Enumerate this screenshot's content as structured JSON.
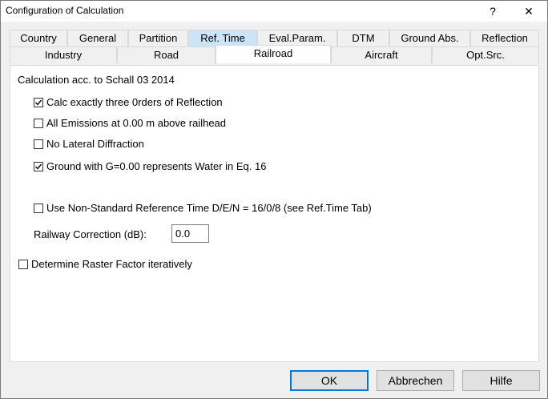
{
  "window": {
    "title": "Configuration of Calculation",
    "help_glyph": "?",
    "close_glyph": "✕"
  },
  "tabs_row1": [
    "Country",
    "General",
    "Partition",
    "Ref. Time",
    "Eval.Param.",
    "DTM",
    "Ground Abs.",
    "Reflection"
  ],
  "tabs_row2": [
    "Industry",
    "Road",
    "Railroad",
    "Aircraft",
    "Opt.Src."
  ],
  "active_tab": "Railroad",
  "highlighted_tab": "Ref. Time",
  "panel": {
    "heading": "Calculation acc. to Schall 03 2014",
    "checkboxes": [
      {
        "label": "Calc exactly three 0rders of Reflection",
        "checked": true
      },
      {
        "label": "All Emissions at 0.00 m above railhead",
        "checked": false
      },
      {
        "label": "No Lateral Diffraction",
        "checked": false
      },
      {
        "label": "Ground with G=0.00 represents Water in Eq. 16",
        "checked": true
      },
      {
        "label": "Use Non-Standard Reference Time D/E/N = 16/0/8 (see Ref.Time Tab)",
        "checked": false
      }
    ],
    "railway_correction_label": "Railway Correction (dB):",
    "railway_correction_value": "0.0",
    "raster_label": "Determine Raster Factor iteratively",
    "raster_checked": false
  },
  "buttons": {
    "ok": "OK",
    "cancel": "Abbrechen",
    "help": "Hilfe"
  }
}
